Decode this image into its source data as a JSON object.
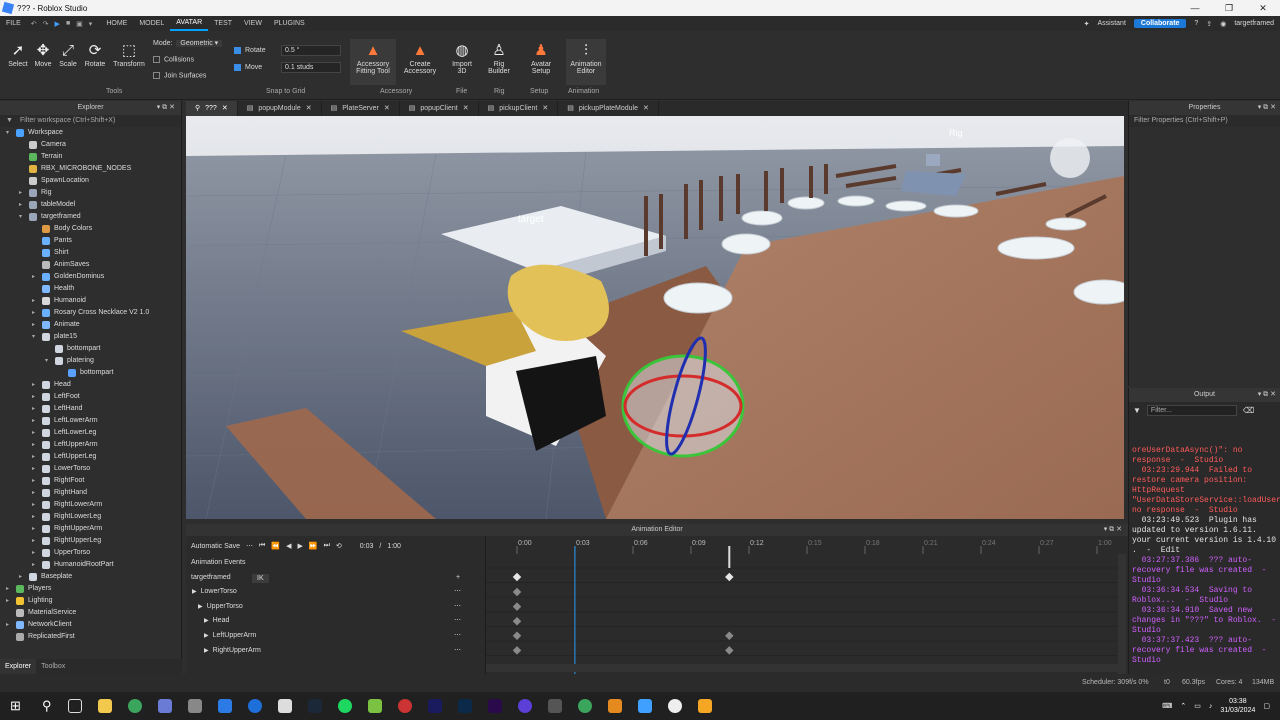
{
  "window": {
    "title": "??? - Roblox Studio",
    "minimize": "—",
    "maximize": "❐",
    "close": "✕"
  },
  "menubar": {
    "file": "FILE",
    "tabs": [
      "HOME",
      "MODEL",
      "AVATAR",
      "TEST",
      "VIEW",
      "PLUGINS"
    ],
    "active_tab": "AVATAR",
    "assistant": "Assistant",
    "collaborate": "Collaborate",
    "user": "targetframed"
  },
  "ribbon": {
    "tools": {
      "select": "Select",
      "move": "Move",
      "scale": "Scale",
      "rotate": "Rotate",
      "transform": "Transform",
      "group": "Tools"
    },
    "mode_label": "Mode:",
    "mode_value": "Geometric",
    "collisions": "Collisions",
    "join_surfaces": "Join Surfaces",
    "snap": {
      "rotate_label": "Rotate",
      "rotate_value": "0.5 °",
      "move_label": "Move",
      "move_value": "0.1 studs",
      "group": "Snap to Grid"
    },
    "accessory": {
      "fitting": "Accessory Fitting Tool",
      "create": "Create Accessory",
      "group": "Accessory"
    },
    "file": {
      "import3d": "Import 3D",
      "group": "File"
    },
    "rig": {
      "builder": "Rig Builder",
      "group": "Rig"
    },
    "setup": {
      "avatar_setup": "Avatar Setup",
      "group": "Setup"
    },
    "animation": {
      "editor": "Animation Editor",
      "group": "Animation"
    }
  },
  "doc_tabs": [
    "???",
    "popupModule",
    "PlateServer",
    "popupClient",
    "pickupClient",
    "pickupPlateModule"
  ],
  "explorer": {
    "title": "Explorer",
    "filter": "Filter workspace (Ctrl+Shift+X)",
    "items": [
      {
        "label": "Workspace",
        "depth": 0,
        "arrow": "▾",
        "icon": "workspace"
      },
      {
        "label": "Camera",
        "depth": 1,
        "arrow": "",
        "icon": "camera"
      },
      {
        "label": "Terrain",
        "depth": 1,
        "arrow": "",
        "icon": "terrain"
      },
      {
        "label": "RBX_MICROBONE_NODES",
        "depth": 1,
        "arrow": "",
        "icon": "folder"
      },
      {
        "label": "SpawnLocation",
        "depth": 1,
        "arrow": "",
        "icon": "spawn"
      },
      {
        "label": "Rig",
        "depth": 1,
        "arrow": "▸",
        "icon": "model"
      },
      {
        "label": "tableModel",
        "depth": 1,
        "arrow": "▸",
        "icon": "model"
      },
      {
        "label": "targetframed",
        "depth": 1,
        "arrow": "▾",
        "icon": "model"
      },
      {
        "label": "Body Colors",
        "depth": 2,
        "arrow": "",
        "icon": "color"
      },
      {
        "label": "Pants",
        "depth": 2,
        "arrow": "",
        "icon": "clothing"
      },
      {
        "label": "Shirt",
        "depth": 2,
        "arrow": "",
        "icon": "clothing"
      },
      {
        "label": "AnimSaves",
        "depth": 2,
        "arrow": "",
        "icon": "anim"
      },
      {
        "label": "GoldenDominus",
        "depth": 2,
        "arrow": "▸",
        "icon": "accessory"
      },
      {
        "label": "Health",
        "depth": 2,
        "arrow": "",
        "icon": "script"
      },
      {
        "label": "Humanoid",
        "depth": 2,
        "arrow": "▸",
        "icon": "humanoid"
      },
      {
        "label": "Rosary Cross Necklace V2 1.0",
        "depth": 2,
        "arrow": "▸",
        "icon": "accessory"
      },
      {
        "label": "Animate",
        "depth": 2,
        "arrow": "▸",
        "icon": "script"
      },
      {
        "label": "plate15",
        "depth": 2,
        "arrow": "▾",
        "icon": "part"
      },
      {
        "label": "bottompart",
        "depth": 3,
        "arrow": "",
        "icon": "part"
      },
      {
        "label": "platering",
        "depth": 3,
        "arrow": "▾",
        "icon": "part"
      },
      {
        "label": "bottompart",
        "depth": 4,
        "arrow": "",
        "icon": "weld"
      },
      {
        "label": "Head",
        "depth": 2,
        "arrow": "▸",
        "icon": "part"
      },
      {
        "label": "LeftFoot",
        "depth": 2,
        "arrow": "▸",
        "icon": "part"
      },
      {
        "label": "LeftHand",
        "depth": 2,
        "arrow": "▸",
        "icon": "part"
      },
      {
        "label": "LeftLowerArm",
        "depth": 2,
        "arrow": "▸",
        "icon": "part"
      },
      {
        "label": "LeftLowerLeg",
        "depth": 2,
        "arrow": "▸",
        "icon": "part"
      },
      {
        "label": "LeftUpperArm",
        "depth": 2,
        "arrow": "▸",
        "icon": "part"
      },
      {
        "label": "LeftUpperLeg",
        "depth": 2,
        "arrow": "▸",
        "icon": "part"
      },
      {
        "label": "LowerTorso",
        "depth": 2,
        "arrow": "▸",
        "icon": "part"
      },
      {
        "label": "RightFoot",
        "depth": 2,
        "arrow": "▸",
        "icon": "part"
      },
      {
        "label": "RightHand",
        "depth": 2,
        "arrow": "▸",
        "icon": "part"
      },
      {
        "label": "RightLowerArm",
        "depth": 2,
        "arrow": "▸",
        "icon": "part"
      },
      {
        "label": "RightLowerLeg",
        "depth": 2,
        "arrow": "▸",
        "icon": "part"
      },
      {
        "label": "RightUpperArm",
        "depth": 2,
        "arrow": "▸",
        "icon": "part"
      },
      {
        "label": "RightUpperLeg",
        "depth": 2,
        "arrow": "▸",
        "icon": "part"
      },
      {
        "label": "UpperTorso",
        "depth": 2,
        "arrow": "▸",
        "icon": "part"
      },
      {
        "label": "HumanoidRootPart",
        "depth": 2,
        "arrow": "▸",
        "icon": "part"
      },
      {
        "label": "Baseplate",
        "depth": 1,
        "arrow": "▸",
        "icon": "part"
      },
      {
        "label": "Players",
        "depth": 0,
        "arrow": "▸",
        "icon": "players"
      },
      {
        "label": "Lighting",
        "depth": 0,
        "arrow": "▸",
        "icon": "lighting"
      },
      {
        "label": "MaterialService",
        "depth": 0,
        "arrow": "",
        "icon": "material"
      },
      {
        "label": "NetworkClient",
        "depth": 0,
        "arrow": "▸",
        "icon": "network"
      },
      {
        "label": "ReplicatedFirst",
        "depth": 0,
        "arrow": "",
        "icon": "replicated"
      }
    ],
    "bottom_tabs": [
      "Explorer",
      "Toolbox"
    ]
  },
  "viewport": {
    "label_rig": "Rig",
    "label_target": "target"
  },
  "properties": {
    "title": "Properties",
    "filter": "Filter Properties (Ctrl+Shift+P)"
  },
  "output": {
    "title": "Output",
    "filter": "Filter...",
    "lines": [
      {
        "text": "oreUserDataAsync()\": no response  -  Studio",
        "kind": "err"
      },
      {
        "text": "  03:23:29.944  Failed to restore camera position: HttpRequest \"UserDataStoreService::loadUserDataAsync()\": no response  -  Studio",
        "kind": "err"
      },
      {
        "text": "  03:23:49.523  Plugin has updated to version 1.6.11. your current version is 1.4.10 .  -  Edit",
        "kind": "wht"
      },
      {
        "text": "  03:27:37.386  ??? auto-recovery file was created  -  Studio",
        "kind": "pur"
      },
      {
        "text": "  03:36:34.534  Saving to Roblox...  -  Studio",
        "kind": "pur"
      },
      {
        "text": "  03:36:34.910  Saved new changes in \"???\" to Roblox.  -  Studio",
        "kind": "pur"
      },
      {
        "text": "  03:37:37.423  ??? auto-recovery file was created  -  Studio",
        "kind": "pur"
      }
    ]
  },
  "animation_editor": {
    "title": "Animation Editor",
    "autosave": "Automatic Save",
    "current_time": "0:03",
    "separator": "/",
    "total_time": "1:00",
    "events_label": "Animation Events",
    "rig_name": "targetframed",
    "ik": "IK",
    "ticks": [
      "0:00",
      "0:03",
      "0:06",
      "0:09",
      "0:12",
      "0:15",
      "0:18",
      "0:21",
      "0:24",
      "0:27",
      "1:00"
    ],
    "tracks": [
      {
        "label": "LowerTorso",
        "indent": 0,
        "arrow": "▶",
        "keys": [
          "0:00"
        ]
      },
      {
        "label": "UpperTorso",
        "indent": 1,
        "arrow": "▶",
        "keys": [
          "0:00"
        ]
      },
      {
        "label": "Head",
        "indent": 2,
        "arrow": "▶",
        "keys": [
          "0:00"
        ]
      },
      {
        "label": "LeftUpperArm",
        "indent": 2,
        "arrow": "▶",
        "keys": [
          "0:00",
          "0:11"
        ]
      },
      {
        "label": "RightUpperArm",
        "indent": 2,
        "arrow": "▶",
        "keys": [
          "0:00",
          "0:11"
        ]
      }
    ],
    "rig_keys": [
      "0:00",
      "0:11"
    ],
    "playhead_time": "0:03",
    "marker_time": "0:11"
  },
  "statusbar": {
    "scheduler": "Scheduler: 309f/s 0%",
    "t0": "t0",
    "fps": "60.3fps",
    "cores": "Cores: 4",
    "mem": "134MB"
  },
  "taskbar": {
    "time": "03:38",
    "date": "31/03/2024"
  }
}
